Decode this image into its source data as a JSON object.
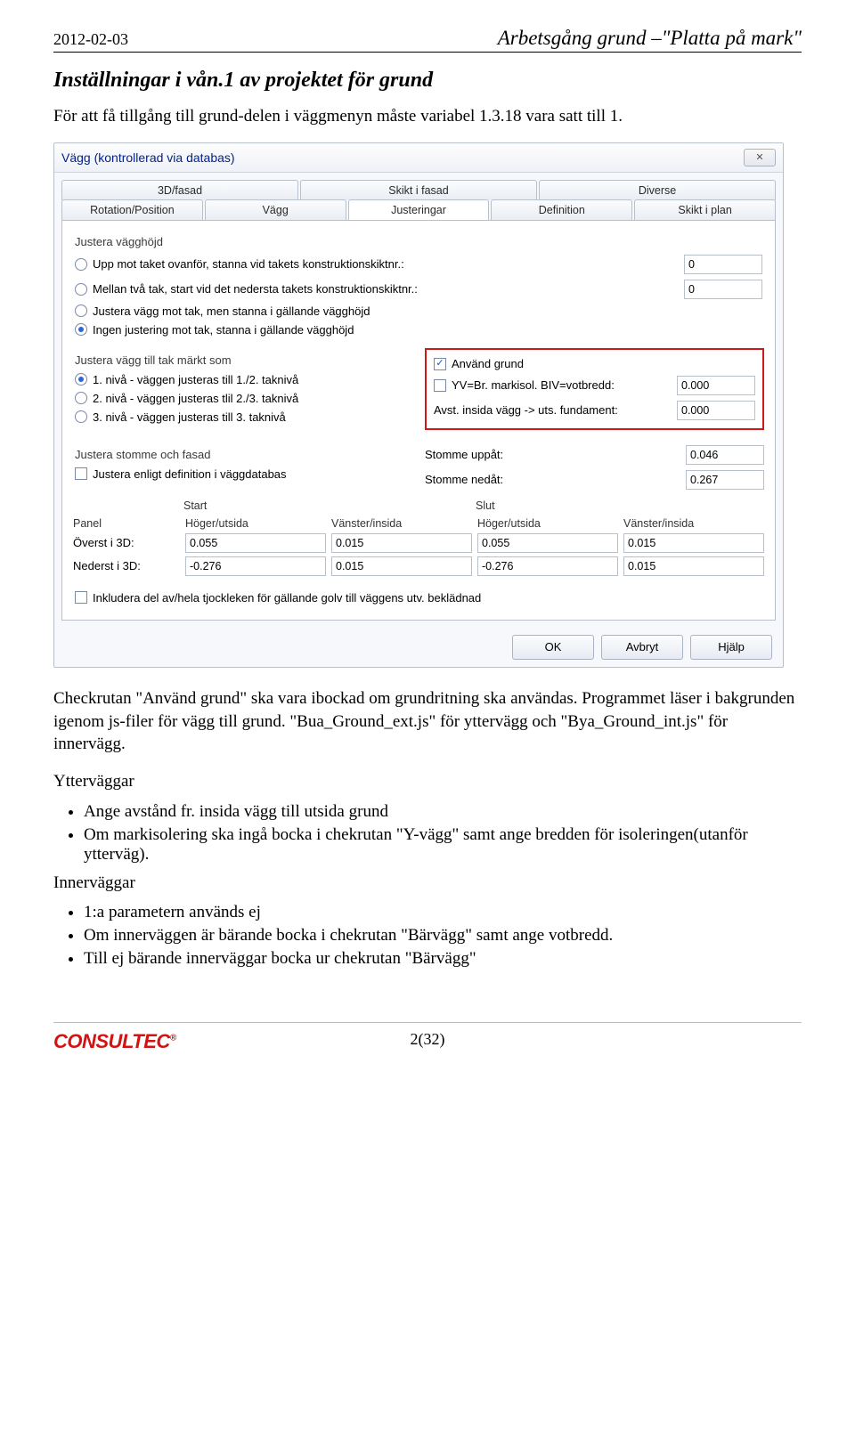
{
  "header": {
    "date": "2012-02-03",
    "doc_title": "Arbetsgång grund –\"Platta på mark\""
  },
  "section": {
    "title": "Inställningar i vån.1 av projektet för grund",
    "intro": "För att få tillgång till grund-delen i väggmenyn måste variabel 1.3.18 vara satt till 1."
  },
  "dialog": {
    "title": "Vägg (kontrollerad via databas)",
    "tabs_row1": [
      "3D/fasad",
      "Skikt i fasad",
      "Diverse"
    ],
    "tabs_row2": [
      "Rotation/Position",
      "Vägg",
      "Justeringar",
      "Definition",
      "Skikt i plan"
    ],
    "active_tab": "Justeringar",
    "grp_adjust_height": "Justera vägghöjd",
    "radios_height": [
      "Upp mot taket ovanför, stanna vid takets konstruktionskiktnr.:",
      "Mellan två tak, start vid det nedersta takets konstruktionskiktnr.:",
      "Justera vägg mot tak, men stanna i gällande vägghöjd",
      "Ingen justering mot tak, stanna i gällande vägghöjd"
    ],
    "height_vals": [
      "0",
      "0"
    ],
    "grp_mark": "Justera vägg till tak märkt som",
    "radios_mark": [
      "1. nivå - väggen justeras till 1./2. taknivå",
      "2. nivå - väggen justeras tlil 2./3. taknivå",
      "3. nivå - väggen justeras till 3. taknivå"
    ],
    "grund": {
      "use_label": "Använd grund",
      "yv_label": "YV=Br. markisol. BIV=votbredd:",
      "yv_val": "0.000",
      "avst_label": "Avst. insida vägg  -> uts. fundament:",
      "avst_val": "0.000"
    },
    "stomme": {
      "grp": "Justera stomme och fasad",
      "chk": "Justera enligt definition i väggdatabas",
      "up_label": "Stomme uppåt:",
      "up_val": "0.046",
      "dn_label": "Stomme nedåt:",
      "dn_val": "0.267"
    },
    "panel_table": {
      "start": "Start",
      "slut": "Slut",
      "row_hdr": "Panel",
      "col1": "Höger/utsida",
      "col2": "Vänster/insida",
      "row1": "Överst i 3D:",
      "row2": "Nederst i 3D:",
      "vals": {
        "r1": [
          "0.055",
          "0.015",
          "0.055",
          "0.015"
        ],
        "r2": [
          "-0.276",
          "0.015",
          "-0.276",
          "0.015"
        ]
      }
    },
    "ink_chk": "Inkludera del av/hela tjockleken för gällande golv till väggens utv. beklädnad",
    "buttons": {
      "ok": "OK",
      "cancel": "Avbryt",
      "help": "Hjälp"
    }
  },
  "body": {
    "p1": "Checkrutan \"Använd grund\" ska vara ibockad om grundritning ska användas. Programmet läser i bakgrunden igenom js-filer för vägg till grund. \"Bua_Ground_ext.js\" för yttervägg och \"Bya_Ground_int.js\" för innervägg.",
    "ytter_h": "Ytterväggar",
    "ytter_items": [
      "Ange avstånd fr. insida vägg till utsida grund",
      "Om markisolering ska ingå bocka i chekrutan \"Y-vägg\" samt ange bredden för isoleringen(utanför ytterväg)."
    ],
    "inner_h": "Innerväggar",
    "inner_items": [
      "1:a parametern används ej",
      "Om innerväggen är bärande bocka i chekrutan \"Bärvägg\" samt ange votbredd.",
      "Till ej bärande innerväggar bocka ur chekrutan \"Bärvägg\""
    ]
  },
  "footer": {
    "logo": "CONSULTEC",
    "page": "2(32)"
  }
}
